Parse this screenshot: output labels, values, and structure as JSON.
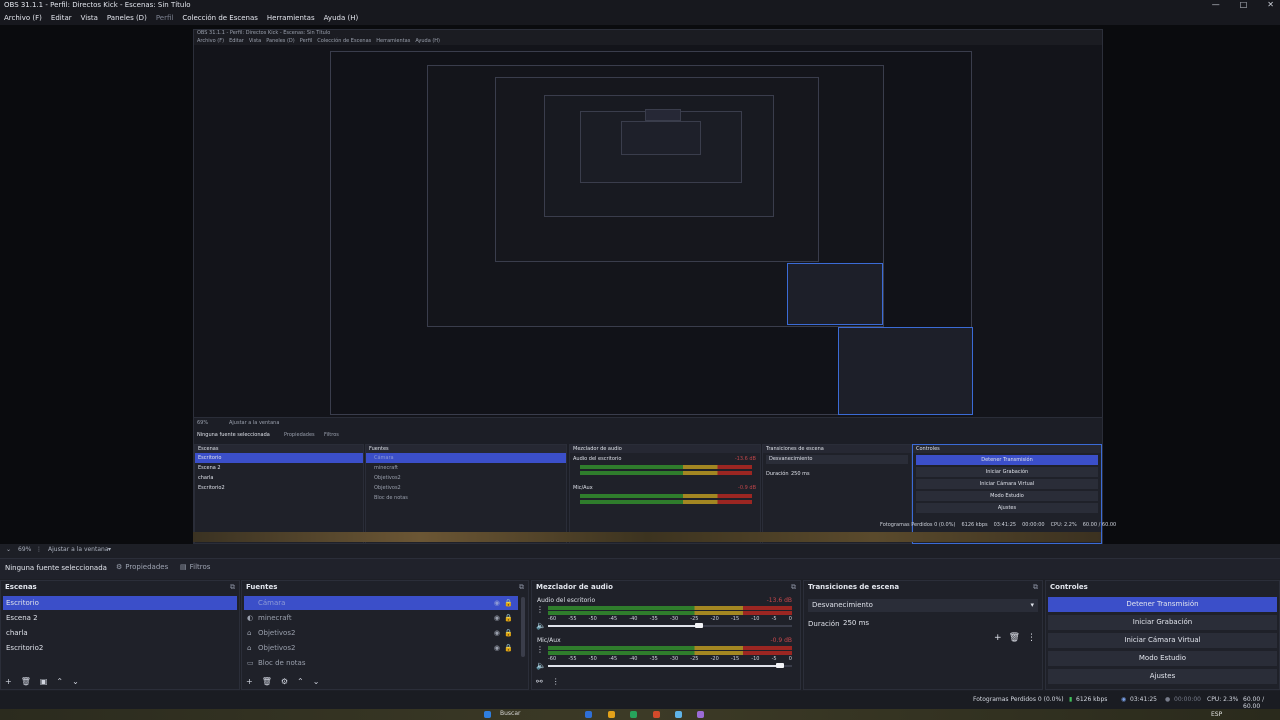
{
  "window": {
    "title": "OBS 31.1.1 - Perfil: Directos Kick - Escenas: Sin Título",
    "controls": [
      "—",
      "□",
      "✕"
    ]
  },
  "menu": [
    "Archivo (F)",
    "Editar",
    "Vista",
    "Paneles (D)",
    "Perfil",
    "Colección de Escenas",
    "Herramientas",
    "Ayuda (H)"
  ],
  "nested": {
    "title": "OBS 31.1.1 - Perfil: Directos Kick - Escenas: Sin Título",
    "menu": [
      "Archivo (F)",
      "Editar",
      "Vista",
      "Paneles (D)",
      "Perfil",
      "Colección de Escenas",
      "Herramientas",
      "Ayuda (H)"
    ],
    "zoom": "69%",
    "fit": "Ajustar a la ventana",
    "no_source": "Ninguna fuente seleccionada",
    "props": "Propiedades",
    "filters": "Filtros",
    "docks": [
      "Escenas",
      "Fuentes",
      "Mezclador de audio",
      "Transiciones de escena",
      "Controles"
    ],
    "scenes": [
      "Escritorio",
      "Escena 2",
      "charla",
      "Escritorio2"
    ],
    "sources": [
      "Cámara",
      "minecraft",
      "Objetivos2",
      "Objetivos2",
      "Bloc de notas"
    ],
    "audio": [
      "Audio del escritorio",
      "Mic/Aux"
    ],
    "audio_db": [
      "-13.6 dB",
      "-0.9 dB"
    ],
    "transition": "Desvanecimiento",
    "duration_label": "Duración",
    "duration": "250 ms",
    "controls": [
      "Detener Transmisión",
      "Iniciar Grabación",
      "Iniciar Cámara Virtual",
      "Modo Estudio",
      "Ajustes"
    ],
    "status": "Fotogramas Perdidos 0 (0.0%)",
    "kbps": "6126 kbps",
    "time": "03:41:25",
    "rec": "00:00:00",
    "cpu": "CPU: 2.2%",
    "fps": "60.00 / 60.00"
  },
  "status_row": {
    "zoom": "69%",
    "fit": "Ajustar a la ventana"
  },
  "source_bar": {
    "none": "Ninguna fuente seleccionada",
    "properties": "Propiedades",
    "filters": "Filtros"
  },
  "scenes": {
    "title": "Escenas",
    "items": [
      "Escritorio",
      "Escena 2",
      "charla",
      "Escritorio2"
    ]
  },
  "sources": {
    "title": "Fuentes",
    "items": [
      "Cámara",
      "minecraft",
      "Objetivos2",
      "Objetivos2",
      "Bloc de notas"
    ]
  },
  "mixer": {
    "title": "Mezclador de audio",
    "channels": [
      {
        "name": "Audio del escritorio",
        "db": "-13.6 dB",
        "level": 0.62
      },
      {
        "name": "Mic/Aux",
        "db": "-0.9 dB",
        "level": 0.95
      }
    ],
    "scale": [
      "-60",
      "-55",
      "-50",
      "-45",
      "-40",
      "-35",
      "-30",
      "-25",
      "-20",
      "-15",
      "-10",
      "-5",
      "0"
    ]
  },
  "transitions": {
    "title": "Transiciones de escena",
    "selected": "Desvanecimiento",
    "duration_label": "Duración",
    "duration": "250 ms"
  },
  "controls": {
    "title": "Controles",
    "buttons": [
      "Detener Transmisión",
      "Iniciar Grabación",
      "Iniciar Cámara Virtual",
      "Modo Estudio",
      "Ajustes"
    ]
  },
  "statusbar": {
    "dropped": "Fotogramas Perdidos 0 (0.0%)",
    "kbps": "6126 kbps",
    "stream_time": "03:41:25",
    "rec_time": "00:00:00",
    "cpu": "CPU: 2.3%",
    "fps": "60.00 / 60.00"
  },
  "taskbar": {
    "search": "Buscar",
    "lang": "ESP",
    "colors": [
      "#2f6fd6",
      "#e3a21a",
      "#27a35b",
      "#d24a2b",
      "#5fb3e8",
      "#9c6bd6"
    ]
  }
}
